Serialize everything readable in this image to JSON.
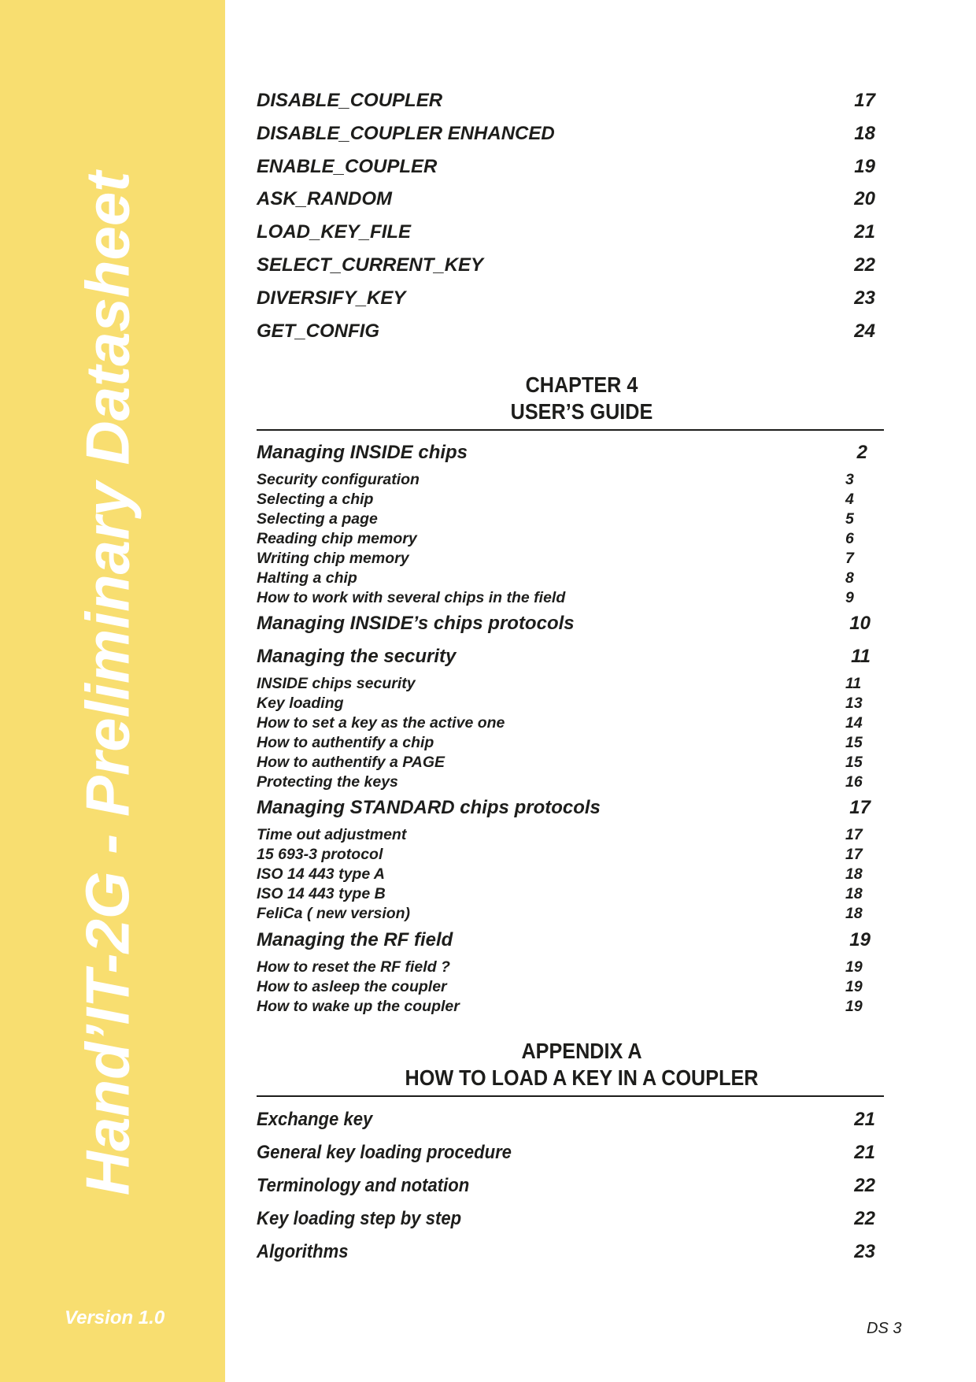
{
  "sidebar": {
    "title": "Hand’IT-2G - Preliminary Datasheet",
    "version": "Version 1.0",
    "band_color": "#F8DE70"
  },
  "commands": [
    {
      "label": "DISABLE_COUPLER",
      "page": "17"
    },
    {
      "label": "DISABLE_COUPLER ENHANCED",
      "page": "18"
    },
    {
      "label": "ENABLE_COUPLER",
      "page": "19"
    },
    {
      "label": "ASK_RANDOM",
      "page": "20"
    },
    {
      "label": "LOAD_KEY_FILE",
      "page": "21"
    },
    {
      "label": "SELECT_CURRENT_KEY",
      "page": "22"
    },
    {
      "label": "DIVERSIFY_KEY",
      "page": "23"
    },
    {
      "label": "GET_CONFIG",
      "page": "24"
    }
  ],
  "chapter4": {
    "line1": "CHAPTER 4",
    "line2": "USER’S GUIDE",
    "sections": [
      {
        "label": "Managing INSIDE chips",
        "page": "2",
        "subs": [
          {
            "label": "Security configuration",
            "page": "3"
          },
          {
            "label": "Selecting a chip",
            "page": "4"
          },
          {
            "label": "Selecting a page",
            "page": "5"
          },
          {
            "label": "Reading chip memory",
            "page": "6"
          },
          {
            "label": "Writing chip memory",
            "page": "7"
          },
          {
            "label": "Halting a chip",
            "page": "8"
          },
          {
            "label": "How to work with several chips in the field",
            "page": "9"
          }
        ]
      },
      {
        "label": "Managing INSIDE’s chips protocols",
        "page": "10",
        "subs": []
      },
      {
        "label": "Managing the security",
        "page": "11",
        "subs": [
          {
            "label": "INSIDE chips security",
            "page": "11"
          },
          {
            "label": "Key loading",
            "page": "13"
          },
          {
            "label": "How to set a key as the active one",
            "page": "14"
          },
          {
            "label": "How to authentify a chip",
            "page": "15"
          },
          {
            "label": "How to authentify a PAGE",
            "page": "15"
          },
          {
            "label": "Protecting the keys",
            "page": "16"
          }
        ]
      },
      {
        "label": "Managing STANDARD chips protocols",
        "page": "17",
        "subs": [
          {
            "label": "Time out adjustment",
            "page": "17"
          },
          {
            "label": "15 693-3 protocol",
            "page": "17"
          },
          {
            "label": "ISO 14 443 type A",
            "page": "18"
          },
          {
            "label": "ISO 14 443 type B",
            "page": "18"
          },
          {
            "label": "FeliCa ( new version)",
            "page": "18"
          }
        ]
      },
      {
        "label": "Managing the RF field",
        "page": "19",
        "subs": [
          {
            "label": "How to reset the RF field ?",
            "page": "19"
          },
          {
            "label": "How to asleep the coupler",
            "page": "19"
          },
          {
            "label": "How to wake up the coupler",
            "page": "19"
          }
        ]
      }
    ]
  },
  "appendixA": {
    "line1": "APPENDIX A",
    "line2": "HOW TO LOAD A KEY IN A COUPLER",
    "entries": [
      {
        "label": "Exchange key",
        "page": "21"
      },
      {
        "label": "General key loading procedure",
        "page": "21"
      },
      {
        "label": "Terminology and notation",
        "page": "22"
      },
      {
        "label": "Key loading step by step",
        "page": "22"
      },
      {
        "label": "Algorithms",
        "page": "23"
      }
    ]
  },
  "footer": {
    "page_label": "DS 3"
  }
}
